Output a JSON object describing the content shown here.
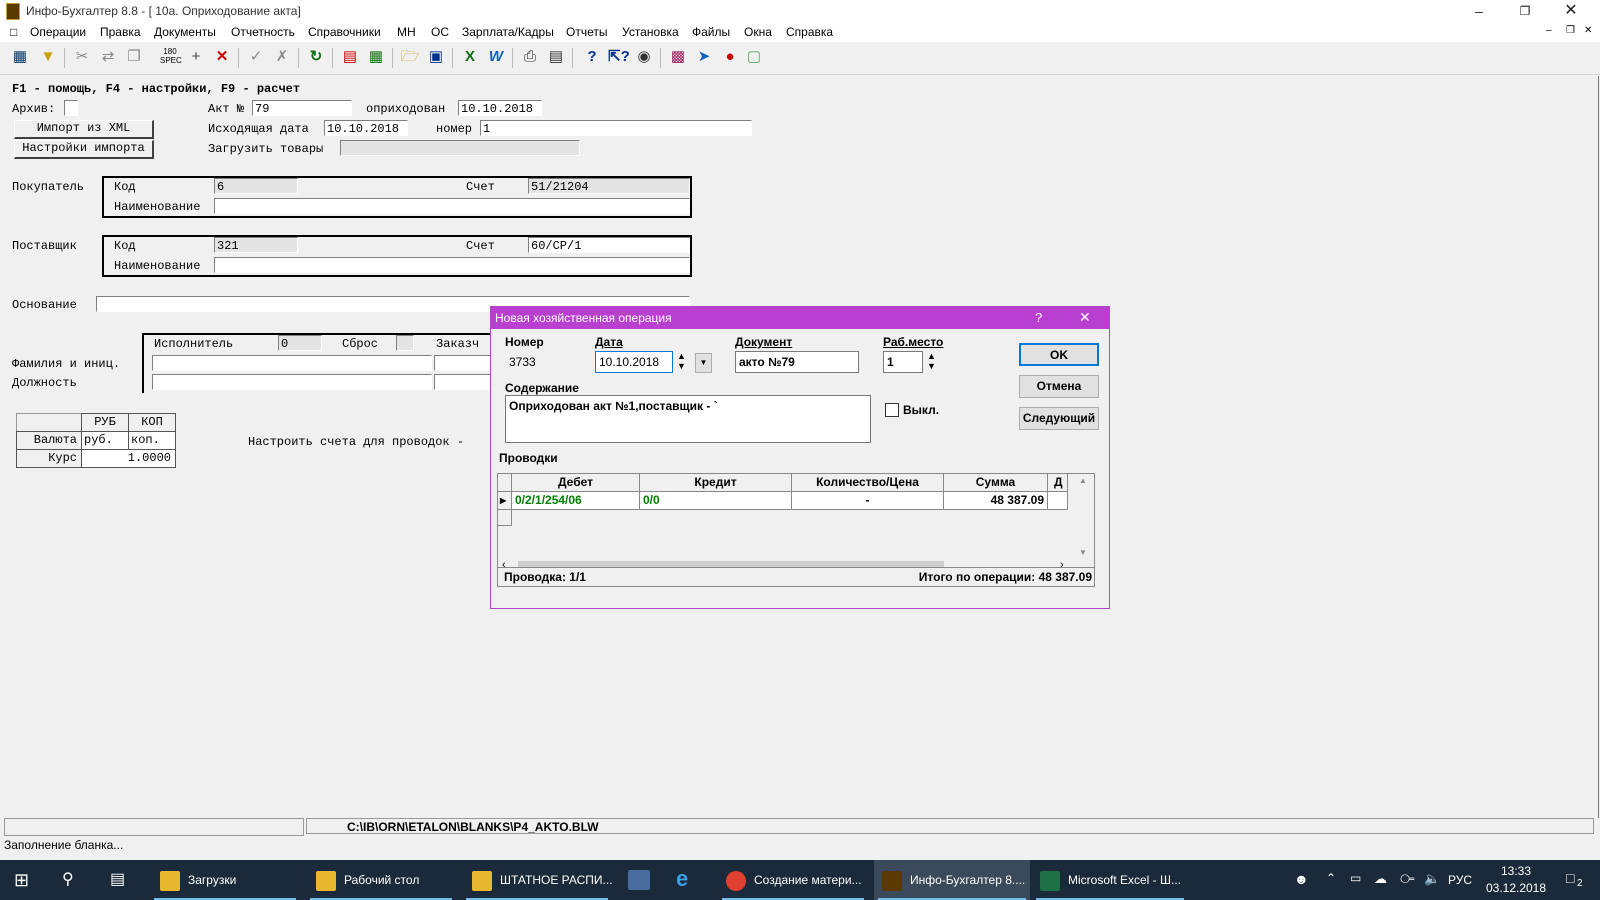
{
  "window": {
    "title": "Инфо-Бухгалтер 8.8 - [ 10а. Оприходование акта]"
  },
  "menu": [
    "Операции",
    "Правка",
    "Документы",
    "Отчетность",
    "Справочники",
    "МН",
    "ОС",
    "Зарплата/Кадры",
    "Отчеты",
    "Установка",
    "Файлы",
    "Окна",
    "Справка"
  ],
  "form": {
    "hint": "F1 - помощь, F4 - настройки, F9 - расчет",
    "archive_label": "Архив:",
    "act_label": "Акт №",
    "act_number": "79",
    "posted_label": "оприходован",
    "posted_date": "10.10.2018",
    "import_xml_button": "Импорт из XML",
    "import_settings_button": "Настройки импорта",
    "outgoing_date_label": "Исходящая дата",
    "outgoing_date": "10.10.2018",
    "number_label": "номер",
    "number_value": "1",
    "load_goods_label": "Загрузить товары",
    "buyer": {
      "label": "Покупатель",
      "code_label": "Код",
      "code": "6",
      "account_label": "Счет",
      "account": "51/21204",
      "name_label": "Наименование",
      "name": ""
    },
    "supplier": {
      "label": "Поставщик",
      "code_label": "Код",
      "code": "321",
      "account_label": "Счет",
      "account": "60/СР/1",
      "name_label": "Наименование",
      "name": ""
    },
    "basis_label": "Основание",
    "executor_label": "Исполнитель",
    "executor_value": "0",
    "reset_label": "Сброс",
    "customer_label": "Заказч",
    "surname_label": "Фамилия и иниц.",
    "position_label": "Должность",
    "currency": {
      "col_rub": "РУБ",
      "col_kop": "КОП",
      "row_currency": "Валюта",
      "rub": "руб.",
      "kop": "коп.",
      "row_rate": "Курс",
      "rate": "1.0000"
    },
    "accounts_setup": "Настроить счета для проводок -",
    "blank_path": "C:\\IB\\ORN\\ETALON\\BLANKS\\P4_AKTO.BLW",
    "status": "Заполнение бланка..."
  },
  "dialog": {
    "title": "Новая хозяйственная операция",
    "number_label": "Номер",
    "number": "3733",
    "date_label": "Дата",
    "date": "10.10.2018",
    "document_label": "Документ",
    "document": "акто №79",
    "workplace_label": "Раб.место",
    "workplace": "1",
    "content_label": "Содержание",
    "content": "Оприходован акт №1,поставщик - `",
    "off_label": "Выкл.",
    "ok": "OK",
    "cancel": "Отмена",
    "next": "Следующий",
    "entries_label": "Проводки",
    "grid_headers": [
      "Дебет",
      "Кредит",
      "Количество/Цена",
      "Сумма",
      "Д"
    ],
    "rows": [
      {
        "debit": "0/2/1/254/06",
        "credit": "0/0",
        "qty": "-",
        "sum": "48 387.09"
      }
    ],
    "footer_left": "Проводка: 1/1",
    "footer_right": "Итого по операции: 48 387.09"
  },
  "taskbar": {
    "items": [
      "Загрузки",
      "Рабочий стол",
      "ШТАТНОЕ РАСПИ...",
      "Создание матери...",
      "Инфо-Бухгалтер 8....",
      "Microsoft Excel - Ш..."
    ],
    "lang": "РУС",
    "time": "13:33",
    "date": "03.12.2018",
    "notif_count": "2"
  },
  "colors": {
    "dialog_title": "#b83fd0",
    "entry_green": "#008000",
    "taskbar": "#1b2a3a"
  }
}
